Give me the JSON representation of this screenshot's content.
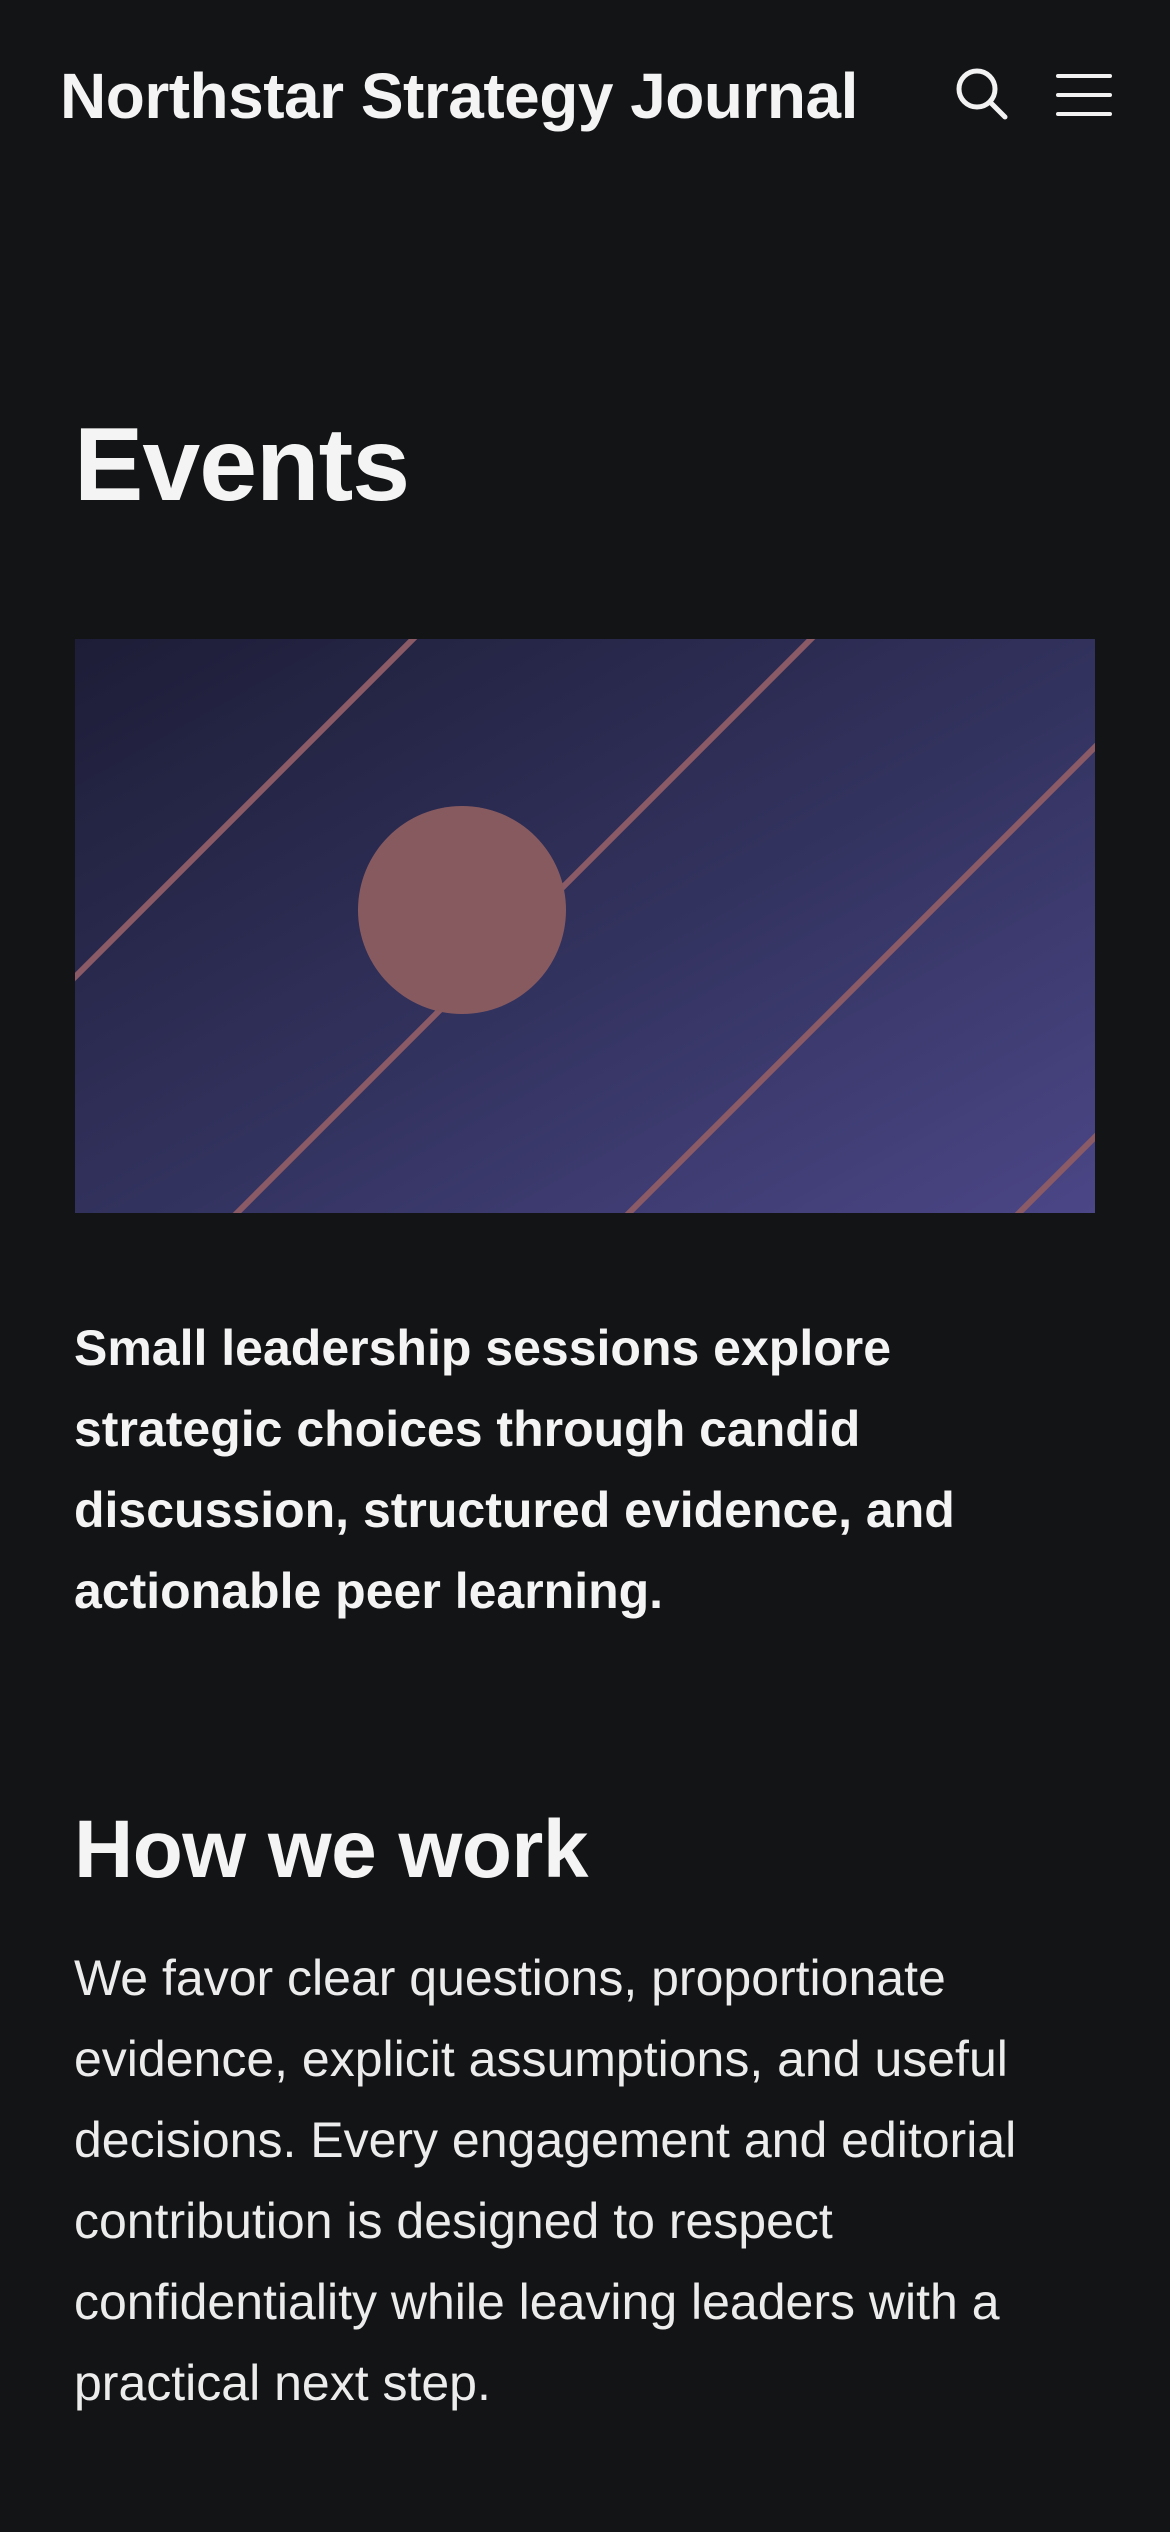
{
  "header": {
    "site_title": "Northstar Strategy Journal",
    "search_icon": "search-icon",
    "menu_icon": "hamburger-menu-icon"
  },
  "main": {
    "page_title": "Events",
    "hero_image": {
      "description": "abstract-gradient-with-circle-and-diagonal-lines",
      "colors": {
        "gradient_start": "#1f1f3a",
        "gradient_end": "#4a4584",
        "accent": "#8a5a5f"
      }
    },
    "lead": "Small leadership sessions explore strategic choices through candid discussion, structured evidence, and actionable peer learning.",
    "section": {
      "heading": "How we work",
      "body": "We favor clear questions, proportionate evidence, explicit assumptions, and useful decisions. Every engagement and editorial contribution is designed to respect confidentiality while leaving leaders with a practical next step."
    }
  },
  "colors": {
    "background": "#131416",
    "text": "#f4f4f4"
  }
}
